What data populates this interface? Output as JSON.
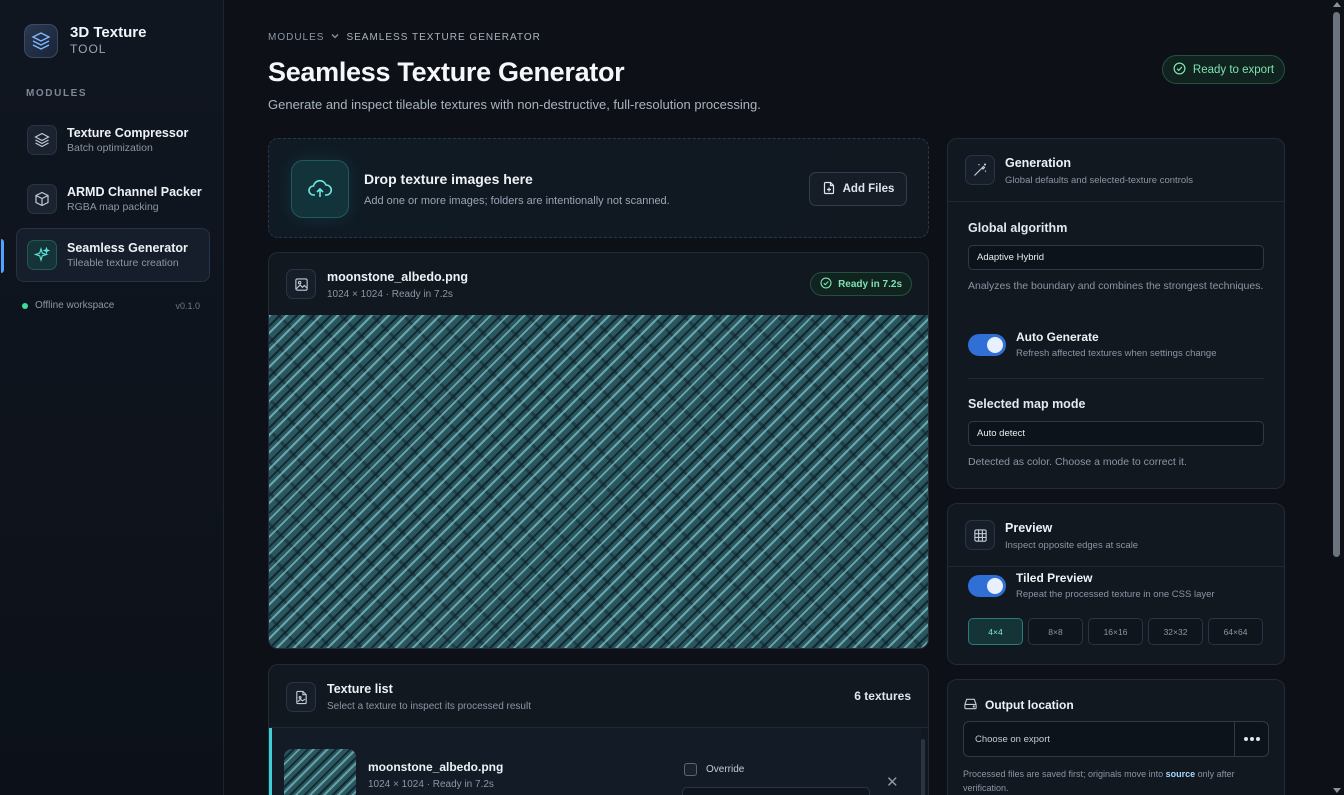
{
  "brand": {
    "title": "3D Texture",
    "subtitle": "TOOL",
    "icon": "layers-stack-icon"
  },
  "sidebar": {
    "heading": "MODULES",
    "items": [
      {
        "label": "Texture Compressor",
        "sub": "Batch optimization",
        "icon": "layers-icon",
        "active": false
      },
      {
        "label": "ARMD Channel Packer",
        "sub": "RGBA map packing",
        "icon": "cube-icon",
        "active": false
      },
      {
        "label": "Seamless Generator",
        "sub": "Tileable texture creation",
        "icon": "sparkles-icon",
        "active": true
      }
    ],
    "status": {
      "label": "Offline workspace",
      "version": "v0.1.0"
    }
  },
  "header": {
    "breadcrumb": [
      "MODULES",
      "SEAMLESS TEXTURE GENERATOR"
    ],
    "title": "Seamless Texture Generator",
    "description": "Generate and inspect tileable textures with non-destructive, full-resolution processing.",
    "status_pill": "Ready to export"
  },
  "dropzone": {
    "title": "Drop texture images here",
    "description": "Add one or more images; folders are intentionally not scanned.",
    "button": "Add Files"
  },
  "viewer": {
    "file_name": "moonstone_albedo.png",
    "meta": "1024 × 1024 · Ready in 7.2s",
    "badge": "Ready in 7.2s"
  },
  "texture_list": {
    "title": "Texture list",
    "subtitle": "Select a texture to inspect its processed result",
    "count": "6 textures",
    "rows": [
      {
        "name": "moonstone_albedo.png",
        "meta": "1024 × 1024 · Ready in 7.2s",
        "override_label": "Override"
      }
    ]
  },
  "generation": {
    "title": "Generation",
    "subtitle": "Global defaults and selected-texture controls",
    "algorithm_label": "Global algorithm",
    "algorithm_value": "Adaptive Hybrid",
    "algorithm_help": "Analyzes the boundary and combines the strongest techniques.",
    "auto_generate_label": "Auto Generate",
    "auto_generate_sub": "Refresh affected textures when settings change",
    "auto_generate_on": true,
    "map_mode_label": "Selected map mode",
    "map_mode_value": "Auto detect",
    "map_mode_help": "Detected as color. Choose a mode to correct it."
  },
  "preview": {
    "title": "Preview",
    "subtitle": "Inspect opposite edges at scale",
    "tiled_label": "Tiled Preview",
    "tiled_sub": "Repeat the processed texture in one CSS layer",
    "tiled_on": true,
    "scales": [
      "4×4",
      "8×8",
      "16×16",
      "32×32",
      "64×64"
    ],
    "active_scale": "4×4"
  },
  "output": {
    "title": "Output location",
    "placeholder": "Choose on export",
    "help_prefix": "Processed files are saved first; originals move into",
    "help_keyword": "source",
    "help_suffix": "only after verification."
  },
  "colors": {
    "accent_blue": "#2f6fd6",
    "accent_teal": "#3ccfd6",
    "success_green": "#7ee2b3",
    "background": "#0d1117"
  }
}
